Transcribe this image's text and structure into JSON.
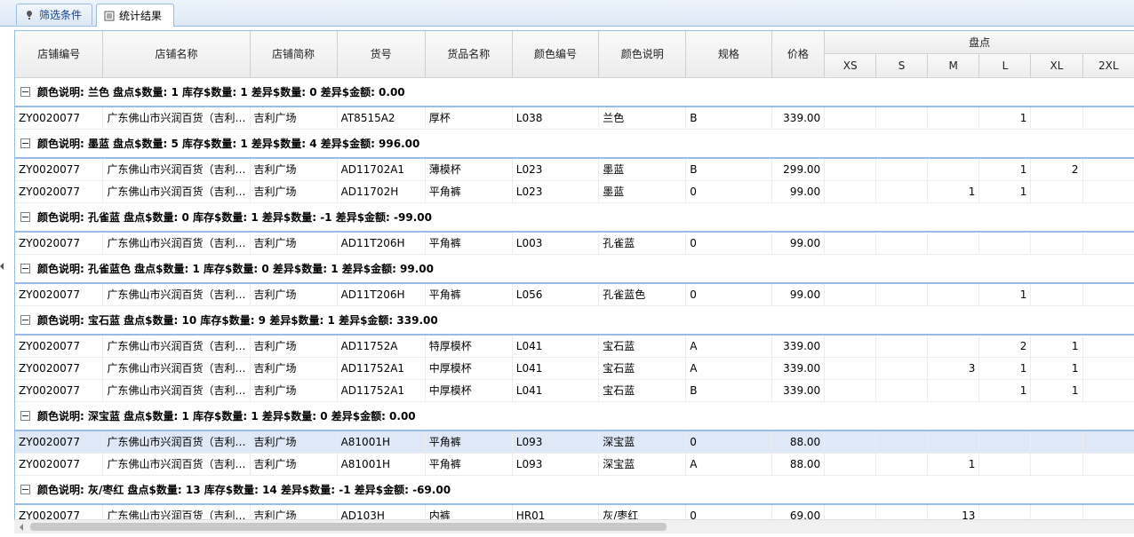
{
  "tabs": [
    {
      "label": "筛选条件",
      "icon": "filter-icon",
      "active": false
    },
    {
      "label": "统计结果",
      "icon": "table-icon",
      "active": true
    }
  ],
  "columns": [
    "店铺编号",
    "店铺名称",
    "店铺简称",
    "货号",
    "货品名称",
    "颜色编号",
    "颜色说明",
    "规格",
    "价格"
  ],
  "group_header": "盘点",
  "size_columns": [
    "XS",
    "S",
    "M",
    "L",
    "XL",
    "2XL"
  ],
  "groups": [
    {
      "label": "颜色说明: 兰色 盘点$数量: 1 库存$数量: 1 差异$数量: 0 差异$金额: 0.00",
      "rows": [
        [
          "ZY0020077",
          "广东佛山市兴润百货（吉利…",
          "吉利广场",
          "AT8515A2",
          "厚杯",
          "L038",
          "兰色",
          "B",
          "339.00",
          "",
          "",
          "",
          "1",
          "",
          ""
        ]
      ]
    },
    {
      "label": "颜色说明: 墨蓝 盘点$数量: 5 库存$数量: 1 差异$数量: 4 差异$金额: 996.00",
      "rows": [
        [
          "ZY0020077",
          "广东佛山市兴润百货（吉利…",
          "吉利广场",
          "AD11702A1",
          "薄模杯",
          "L023",
          "墨蓝",
          "B",
          "299.00",
          "",
          "",
          "",
          "1",
          "2",
          ""
        ],
        [
          "ZY0020077",
          "广东佛山市兴润百货（吉利…",
          "吉利广场",
          "AD11702H",
          "平角裤",
          "L023",
          "墨蓝",
          "0",
          "99.00",
          "",
          "",
          "1",
          "1",
          "",
          ""
        ]
      ]
    },
    {
      "label": "颜色说明: 孔雀蓝 盘点$数量: 0 库存$数量: 1 差异$数量: -1 差异$金额: -99.00",
      "rows": [
        [
          "ZY0020077",
          "广东佛山市兴润百货（吉利…",
          "吉利广场",
          "AD11T206H",
          "平角裤",
          "L003",
          "孔雀蓝",
          "0",
          "99.00",
          "",
          "",
          "",
          "",
          "",
          ""
        ]
      ]
    },
    {
      "label": "颜色说明: 孔雀蓝色 盘点$数量: 1 库存$数量: 0 差异$数量: 1 差异$金额: 99.00",
      "rows": [
        [
          "ZY0020077",
          "广东佛山市兴润百货（吉利…",
          "吉利广场",
          "AD11T206H",
          "平角裤",
          "L056",
          "孔雀蓝色",
          "0",
          "99.00",
          "",
          "",
          "",
          "1",
          "",
          ""
        ]
      ]
    },
    {
      "label": "颜色说明: 宝石蓝 盘点$数量: 10 库存$数量: 9 差异$数量: 1 差异$金额: 339.00",
      "rows": [
        [
          "ZY0020077",
          "广东佛山市兴润百货（吉利…",
          "吉利广场",
          "AD11752A",
          "特厚模杯",
          "L041",
          "宝石蓝",
          "A",
          "339.00",
          "",
          "",
          "",
          "2",
          "1",
          ""
        ],
        [
          "ZY0020077",
          "广东佛山市兴润百货（吉利…",
          "吉利广场",
          "AD11752A1",
          "中厚模杯",
          "L041",
          "宝石蓝",
          "A",
          "339.00",
          "",
          "",
          "3",
          "1",
          "1",
          ""
        ],
        [
          "ZY0020077",
          "广东佛山市兴润百货（吉利…",
          "吉利广场",
          "AD11752A1",
          "中厚模杯",
          "L041",
          "宝石蓝",
          "B",
          "339.00",
          "",
          "",
          "",
          "1",
          "1",
          ""
        ]
      ]
    },
    {
      "label": "颜色说明: 深宝蓝 盘点$数量: 1 库存$数量: 1 差异$数量: 0 差异$金额: 0.00",
      "rows": [
        [
          "ZY0020077",
          "广东佛山市兴润百货（吉利…",
          "吉利广场",
          "A81001H",
          "平角裤",
          "L093",
          "深宝蓝",
          "0",
          "88.00",
          "",
          "",
          "",
          "",
          "",
          ""
        ],
        [
          "ZY0020077",
          "广东佛山市兴润百货（吉利…",
          "吉利广场",
          "A81001H",
          "平角裤",
          "L093",
          "深宝蓝",
          "A",
          "88.00",
          "",
          "",
          "1",
          "",
          "",
          ""
        ]
      ]
    },
    {
      "label": "颜色说明: 灰/枣红 盘点$数量: 13 库存$数量: 14 差异$数量: -1 差异$金额: -69.00",
      "rows": [
        [
          "ZY0020077",
          "广东佛山市兴润百货（吉利…",
          "吉利广场",
          "AD103H",
          "内裤",
          "HR01",
          "灰/枣红",
          "0",
          "69.00",
          "",
          "",
          "13",
          "",
          "",
          ""
        ]
      ]
    }
  ],
  "selected_row": {
    "group": 5,
    "row": 0
  }
}
